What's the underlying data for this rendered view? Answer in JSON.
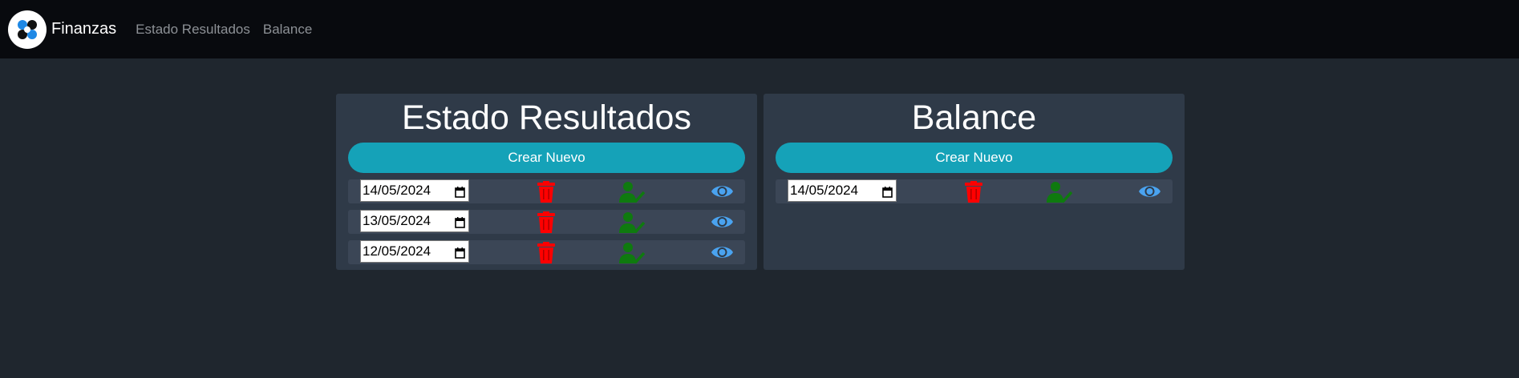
{
  "navbar": {
    "brand": "Finanzas",
    "links": [
      "Estado Resultados",
      "Balance"
    ]
  },
  "panels": [
    {
      "title": "Estado Resultados",
      "create_label": "Crear Nuevo",
      "dates": [
        "14/05/2024",
        "13/05/2024",
        "12/05/2024"
      ]
    },
    {
      "title": "Balance",
      "create_label": "Crear Nuevo",
      "dates": [
        "14/05/2024"
      ]
    }
  ],
  "icons": {
    "delete": "trash-icon",
    "approve": "user-check-icon",
    "view": "eye-icon",
    "calendar": "calendar-icon"
  },
  "colors": {
    "navbar_bg": "#080a0e",
    "page_bg": "#1f262e",
    "panel_bg": "#2f3a48",
    "row_bg": "#3b4656",
    "button_bg": "#15a2b8",
    "trash": "#ff0000",
    "user_check": "#0f7a0f",
    "eye": "#4aa3f0"
  }
}
